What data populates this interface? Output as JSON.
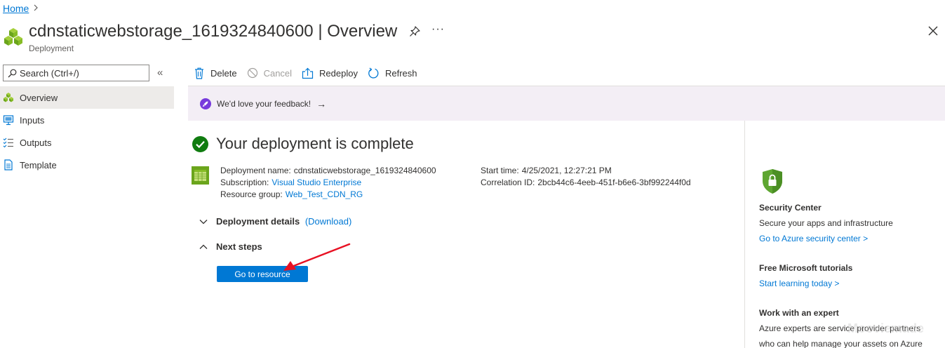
{
  "breadcrumb": {
    "home": "Home",
    "separator": ">"
  },
  "header": {
    "title": "cdnstaticwebstorage_1619324840600 | Overview",
    "subtitle": "Deployment",
    "more": "···"
  },
  "nav": {
    "search_placeholder": "Search (Ctrl+/)",
    "collapse": "«",
    "items": [
      {
        "label": "Overview",
        "icon": "deployment-icon",
        "active": true
      },
      {
        "label": "Inputs",
        "icon": "inputs-icon"
      },
      {
        "label": "Outputs",
        "icon": "outputs-icon"
      },
      {
        "label": "Template",
        "icon": "template-icon"
      }
    ]
  },
  "toolbar": {
    "delete": "Delete",
    "cancel": "Cancel",
    "redeploy": "Redeploy",
    "refresh": "Refresh"
  },
  "banner": {
    "text": "We'd love your feedback!",
    "arrow": "→"
  },
  "status": {
    "title": "Your deployment is complete"
  },
  "details": {
    "deployment_name_label": "Deployment name:",
    "deployment_name": "cdnstaticwebstorage_1619324840600",
    "subscription_label": "Subscription:",
    "subscription": "Visual Studio Enterprise",
    "resource_group_label": "Resource group:",
    "resource_group": "Web_Test_CDN_RG",
    "start_time_label": "Start time:",
    "start_time": "4/25/2021, 12:27:21 PM",
    "correlation_label": "Correlation ID:",
    "correlation_id": "2bcb44c6-4eeb-451f-b6e6-3bf992244f0d"
  },
  "sections": {
    "deployment_details": "Deployment details",
    "download": "(Download)",
    "next_steps": "Next steps"
  },
  "go_button": "Go to resource",
  "right_panel": {
    "security_title": "Security Center",
    "security_text": "Secure your apps and infrastructure",
    "security_link": "Go to Azure security center >",
    "tutorials_title": "Free Microsoft tutorials",
    "tutorials_link": "Start learning today >",
    "expert_title": "Work with an expert",
    "expert_text1": "Azure experts are service provider partners",
    "expert_text2": "who can help manage your assets on Azure"
  },
  "watermark": "Mooviemade",
  "colors": {
    "accent": "#0078d4",
    "success": "#107c10",
    "banner_bg": "#f3eef5",
    "arrow_annotation": "#e81123"
  }
}
